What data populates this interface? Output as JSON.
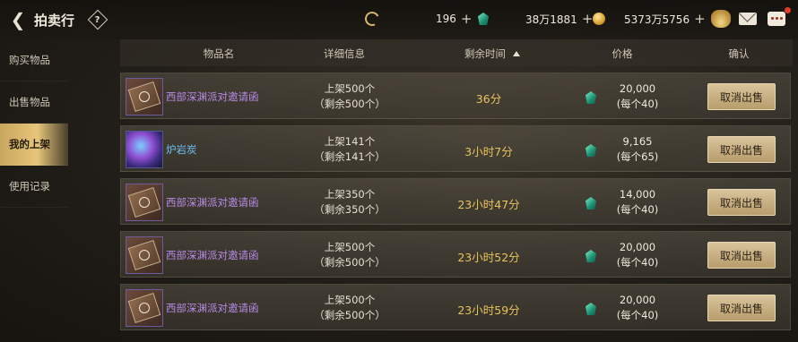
{
  "topbar": {
    "title": "拍卖行",
    "help_label": "?",
    "res1_value": "196",
    "res2_value": "38万1881",
    "res3_value": "5373万5756",
    "plus": "+"
  },
  "sidebar": {
    "items": [
      {
        "label": "购买物品"
      },
      {
        "label": "出售物品"
      },
      {
        "label": "我的上架"
      },
      {
        "label": "使用记录"
      }
    ],
    "active_index": 2
  },
  "table": {
    "headers": {
      "name": "物品名",
      "detail": "详细信息",
      "time": "剩余时间",
      "price": "价格",
      "confirm": "确认"
    },
    "rows": [
      {
        "name": "西部深渊派对邀请函",
        "detail1": "上架500个",
        "detail2": "（剩余500个）",
        "time": "36分",
        "price": "20,000",
        "unit": "(每个40)",
        "action": "取消出售"
      },
      {
        "name": "炉岩炭",
        "detail1": "上架141个",
        "detail2": "（剩余141个）",
        "time": "3小时7分",
        "price": "9,165",
        "unit": "(每个65)",
        "action": "取消出售"
      },
      {
        "name": "西部深渊派对邀请函",
        "detail1": "上架350个",
        "detail2": "（剩余350个）",
        "time": "23小时47分",
        "price": "14,000",
        "unit": "(每个40)",
        "action": "取消出售"
      },
      {
        "name": "西部深渊派对邀请函",
        "detail1": "上架500个",
        "detail2": "（剩余500个）",
        "time": "23小时52分",
        "price": "20,000",
        "unit": "(每个40)",
        "action": "取消出售"
      },
      {
        "name": "西部深渊派对邀请函",
        "detail1": "上架500个",
        "detail2": "（剩余500个）",
        "time": "23小时59分",
        "price": "20,000",
        "unit": "(每个40)",
        "action": "取消出售"
      }
    ]
  }
}
